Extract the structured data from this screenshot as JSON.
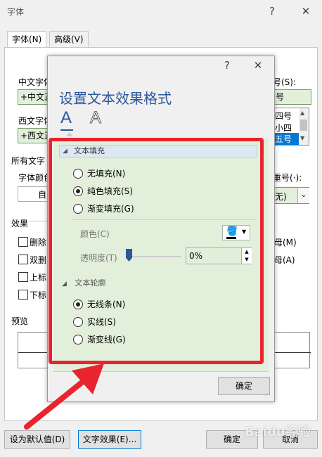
{
  "outer": {
    "title": "字体",
    "help_glyph": "?",
    "close_glyph": "✕",
    "tabs": [
      {
        "label": "字体(N)"
      },
      {
        "label": "高级(V)"
      }
    ],
    "labels": {
      "chinese_font": "中文字体",
      "chinese_font_value": "+中文正",
      "western_font": "西文字体",
      "western_font_value": "+西文正",
      "all_text": "所有文字",
      "font_color": "字体颜色",
      "font_color_value": "自",
      "effects": "效果",
      "preview": "预览",
      "size_label": "号(S):",
      "size_value": "号",
      "size_list": [
        "四号",
        "小四",
        "五号"
      ],
      "emphasis_label": "重号(·):",
      "emphasis_value": "无)",
      "effects_left": [
        "删除",
        "双删",
        "上标",
        "下标"
      ],
      "effects_right": [
        "母(M)",
        "母(A)"
      ]
    },
    "buttons": {
      "set_default": "设为默认值(D)",
      "text_effects": "文字效果(E)...",
      "ok": "确定",
      "cancel": "取消"
    }
  },
  "inner": {
    "help_glyph": "?",
    "close_glyph": "✕",
    "title": "设置文本效果格式",
    "fill_section": {
      "header": "文本填充",
      "options": [
        {
          "label": "无填充(N)",
          "selected": false
        },
        {
          "label": "纯色填充(S)",
          "selected": true
        },
        {
          "label": "渐变填充(G)",
          "selected": false
        }
      ],
      "color_label": "颜色(C)",
      "transparency_label": "透明度(T)",
      "transparency_value": "0%"
    },
    "outline_section": {
      "header": "文本轮廓",
      "options": [
        {
          "label": "无线条(N)",
          "selected": true
        },
        {
          "label": "实线(S)",
          "selected": false
        },
        {
          "label": "渐变线(G)",
          "selected": false
        }
      ]
    },
    "ok_button": "确定"
  },
  "colors": {
    "highlight_green": "#e2efda",
    "annotation_red": "#e8242e",
    "title_blue": "#2b579a"
  },
  "watermark": "Baidu经验"
}
